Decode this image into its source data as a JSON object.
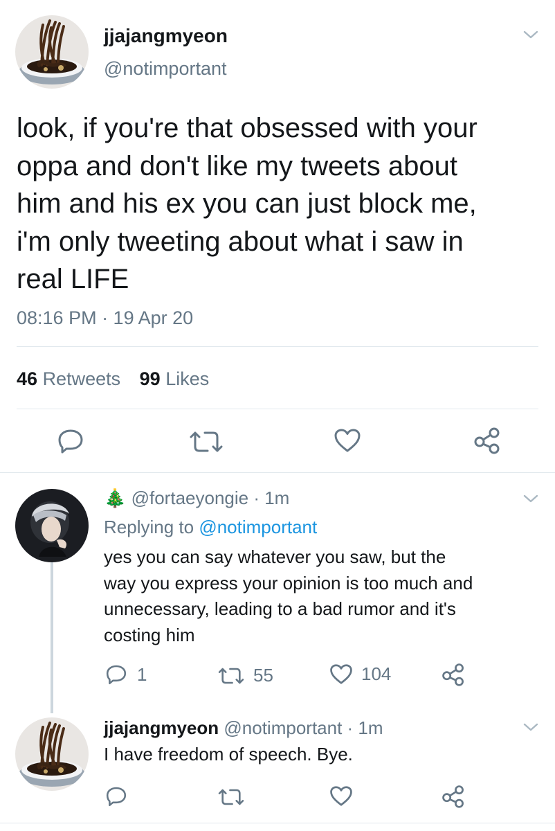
{
  "main_tweet": {
    "display_name": "jjajangmyeon",
    "handle": "@notimportant",
    "text_lines": [
      "look, if you're that obsessed with your",
      "oppa and don't like my tweets about",
      "him and his ex you can just block me,",
      "i'm only tweeting about what i saw in",
      "real LIFE"
    ],
    "time": "08:16 PM · 19 Apr 20",
    "retweets_count": "46",
    "retweets_label": "Retweets",
    "likes_count": "99",
    "likes_label": "Likes"
  },
  "reply1": {
    "emoji": "🎄",
    "handle": "@fortaeyongie",
    "time": "· 1m",
    "replying_prefix": "Replying to",
    "replying_to": "@notimportant",
    "text_lines": [
      "yes you can say whatever you saw, but the",
      "way you express your opinion is too much and",
      "unnecessary, leading to a bad rumor and it's",
      "costing him"
    ],
    "reply_count": "1",
    "retweet_count": "55",
    "like_count": "104"
  },
  "reply2": {
    "display_name": "jjajangmyeon",
    "handle": "@notimportant",
    "time": "· 1m",
    "text": "I have freedom of speech. Bye."
  },
  "icons": [
    "chevron-down-icon",
    "reply-icon",
    "retweet-icon",
    "like-icon",
    "share-icon"
  ],
  "colors": {
    "text": "#14171a",
    "secondary": "#657786",
    "link": "#1b95e0",
    "divider": "#e1e8ed"
  }
}
